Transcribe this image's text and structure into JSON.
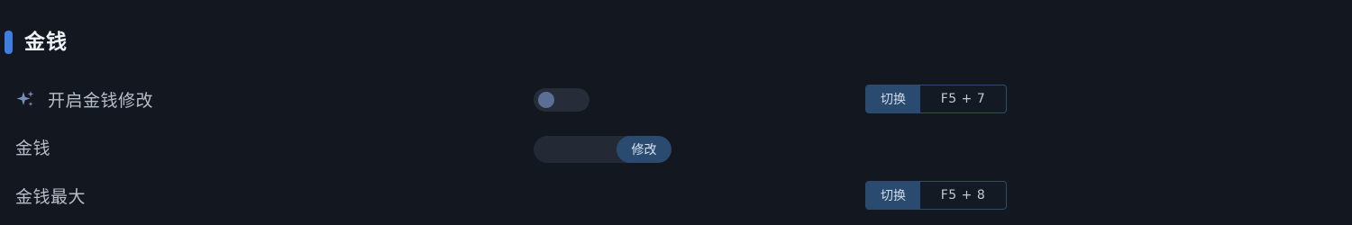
{
  "section": {
    "title": "金钱"
  },
  "rows": [
    {
      "label": "开启金钱修改",
      "icon": "sparkle-icon",
      "control": "toggle",
      "enabled": false,
      "hotkey": {
        "action_label": "切换",
        "keys": "F5 + 7"
      }
    },
    {
      "label": "金钱",
      "control": "number-input",
      "value": "",
      "button_label": "修改"
    },
    {
      "label": "金钱最大",
      "hotkey": {
        "action_label": "切换",
        "keys": "F5 + 8"
      }
    }
  ],
  "colors": {
    "background": "#121720",
    "accent": "#3d7ee0",
    "button": "#2b4a6f"
  }
}
